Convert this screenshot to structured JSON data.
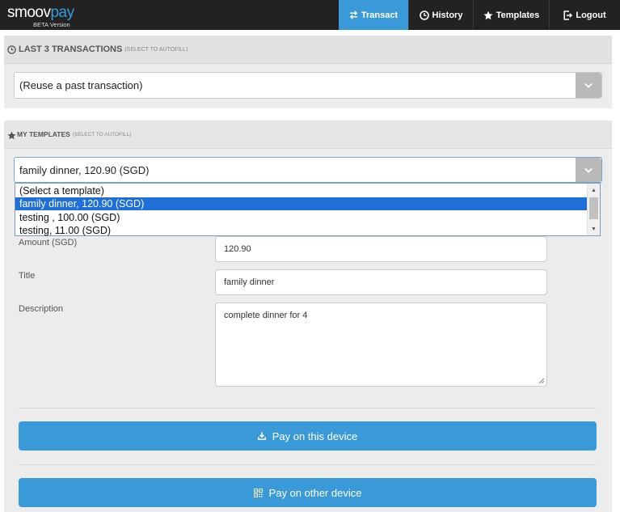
{
  "nav": {
    "logo_word_a": "smoov",
    "logo_word_b": "pay",
    "logo_sub": "BETA Version",
    "items": [
      {
        "label": "Transact",
        "icon": "transfer-arrows-icon",
        "active": true
      },
      {
        "label": "History",
        "icon": "clock-icon",
        "active": false
      },
      {
        "label": "Templates",
        "icon": "star-icon",
        "active": false
      },
      {
        "label": "Logout",
        "icon": "logout-icon",
        "active": false
      }
    ]
  },
  "last_transactions": {
    "title": "LAST 3 TRANSACTIONS",
    "hint": "(SELECT TO AUTOFILL)",
    "select_value": "(Reuse a past transaction)"
  },
  "templates": {
    "title": "MY TEMPLATES",
    "hint": "(SELECT TO AUTOFILL)",
    "select_value": "family dinner, 120.90 (SGD)",
    "options": [
      "(Select a template)",
      "family dinner, 120.90 (SGD)",
      "testing , 100.00 (SGD)",
      "testing, 11.00 (SGD)"
    ],
    "selected_index": 1
  },
  "form": {
    "amount_label": "Amount (SGD)",
    "amount_value": "120.90",
    "title_label": "Title",
    "title_value": "family dinner",
    "description_label": "Description",
    "description_value": "complete dinner for 4"
  },
  "actions": {
    "pay_this_device": "Pay on this device",
    "pay_other_device": "Pay on other device"
  },
  "colors": {
    "accent": "#3a9ad9",
    "navbar": "#222222",
    "selected_option": "#1e6fd9"
  }
}
